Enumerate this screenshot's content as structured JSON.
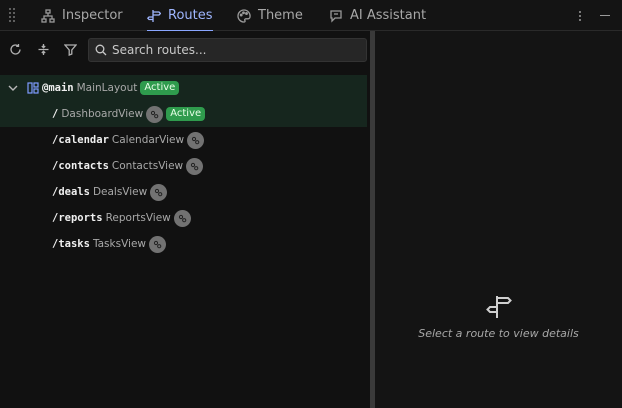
{
  "tabs": [
    {
      "label": "Inspector",
      "icon": "sitemap-icon",
      "active": false
    },
    {
      "label": "Routes",
      "icon": "signpost-icon",
      "active": true
    },
    {
      "label": "Theme",
      "icon": "palette-icon",
      "active": false
    },
    {
      "label": "AI Assistant",
      "icon": "chat-icon",
      "active": false
    }
  ],
  "toolbar": {
    "search_placeholder": "Search routes..."
  },
  "routes": {
    "parent": {
      "path": "@main",
      "component": "MainLayout",
      "badge": "Active",
      "expanded": true
    },
    "children": [
      {
        "path": "/",
        "component": "DashboardView",
        "lazy": true,
        "badge": "Active",
        "selected": true
      },
      {
        "path": "/calendar",
        "component": "CalendarView",
        "lazy": true
      },
      {
        "path": "/contacts",
        "component": "ContactsView",
        "lazy": true
      },
      {
        "path": "/deals",
        "component": "DealsView",
        "lazy": true
      },
      {
        "path": "/reports",
        "component": "ReportsView",
        "lazy": true
      },
      {
        "path": "/tasks",
        "component": "TasksView",
        "lazy": true
      }
    ]
  },
  "details": {
    "empty_text": "Select a route to view details",
    "icon": "signpost-icon"
  },
  "colors": {
    "accent": "#8aa6ff",
    "active_badge": "#2f9b4d",
    "selected_row": "#16261e"
  }
}
